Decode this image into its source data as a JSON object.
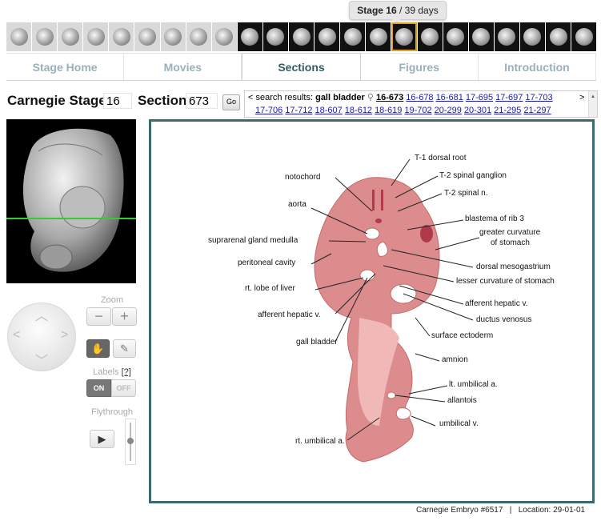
{
  "tooltip": {
    "stage": "Stage 16",
    "days": " / 39 days"
  },
  "stages": {
    "count": 23,
    "selected_index": 15
  },
  "tabs": [
    {
      "label": "Stage Home"
    },
    {
      "label": "Movies"
    },
    {
      "label": "Sections"
    },
    {
      "label": "Figures"
    },
    {
      "label": "Introduction"
    }
  ],
  "controls": {
    "stage_label": "Carnegie Stage",
    "stage_value": "16",
    "section_label": "Section",
    "section_value": "673",
    "go_label": "Go"
  },
  "search": {
    "prev": "<",
    "prefix": "search results:",
    "query": "gall bladder",
    "next": ">",
    "results": [
      "16-673",
      "16-678",
      "16-681",
      "17-695",
      "17-697",
      "17-703",
      "17-706",
      "17-712",
      "18-607",
      "18-612",
      "18-619",
      "19-702",
      "20-299",
      "20-301",
      "21-295",
      "21-297"
    ]
  },
  "tools": {
    "zoom_label": "Zoom",
    "zoom_out": "−",
    "zoom_in": "+",
    "labels_label": "Labels",
    "labels_help": "[?]",
    "on": "ON",
    "off": "OFF",
    "flythrough_label": "Flythrough"
  },
  "annotations": [
    "T-1 dorsal root",
    "notochord",
    "T-2 spinal ganglion",
    "T-2 spinal n.",
    "aorta",
    "blastema of rib 3",
    "greater curvature",
    "of stomach",
    "suprarenal gland medulla",
    "peritoneal cavity",
    "dorsal mesogastrium",
    "lesser curvature of stomach",
    "rt. lobe of liver",
    "afferent hepatic v.",
    "afferent hepatic v.",
    "ductus venosus",
    "surface ectoderm",
    "gall bladder",
    "amnion",
    "lt. umbilical a.",
    "allantois",
    "umbilical v.",
    "rt. umbilical a."
  ],
  "footer": {
    "embryo": "Carnegie Embryo #6517",
    "sep": "|",
    "location": "Location: 29-01-01"
  }
}
